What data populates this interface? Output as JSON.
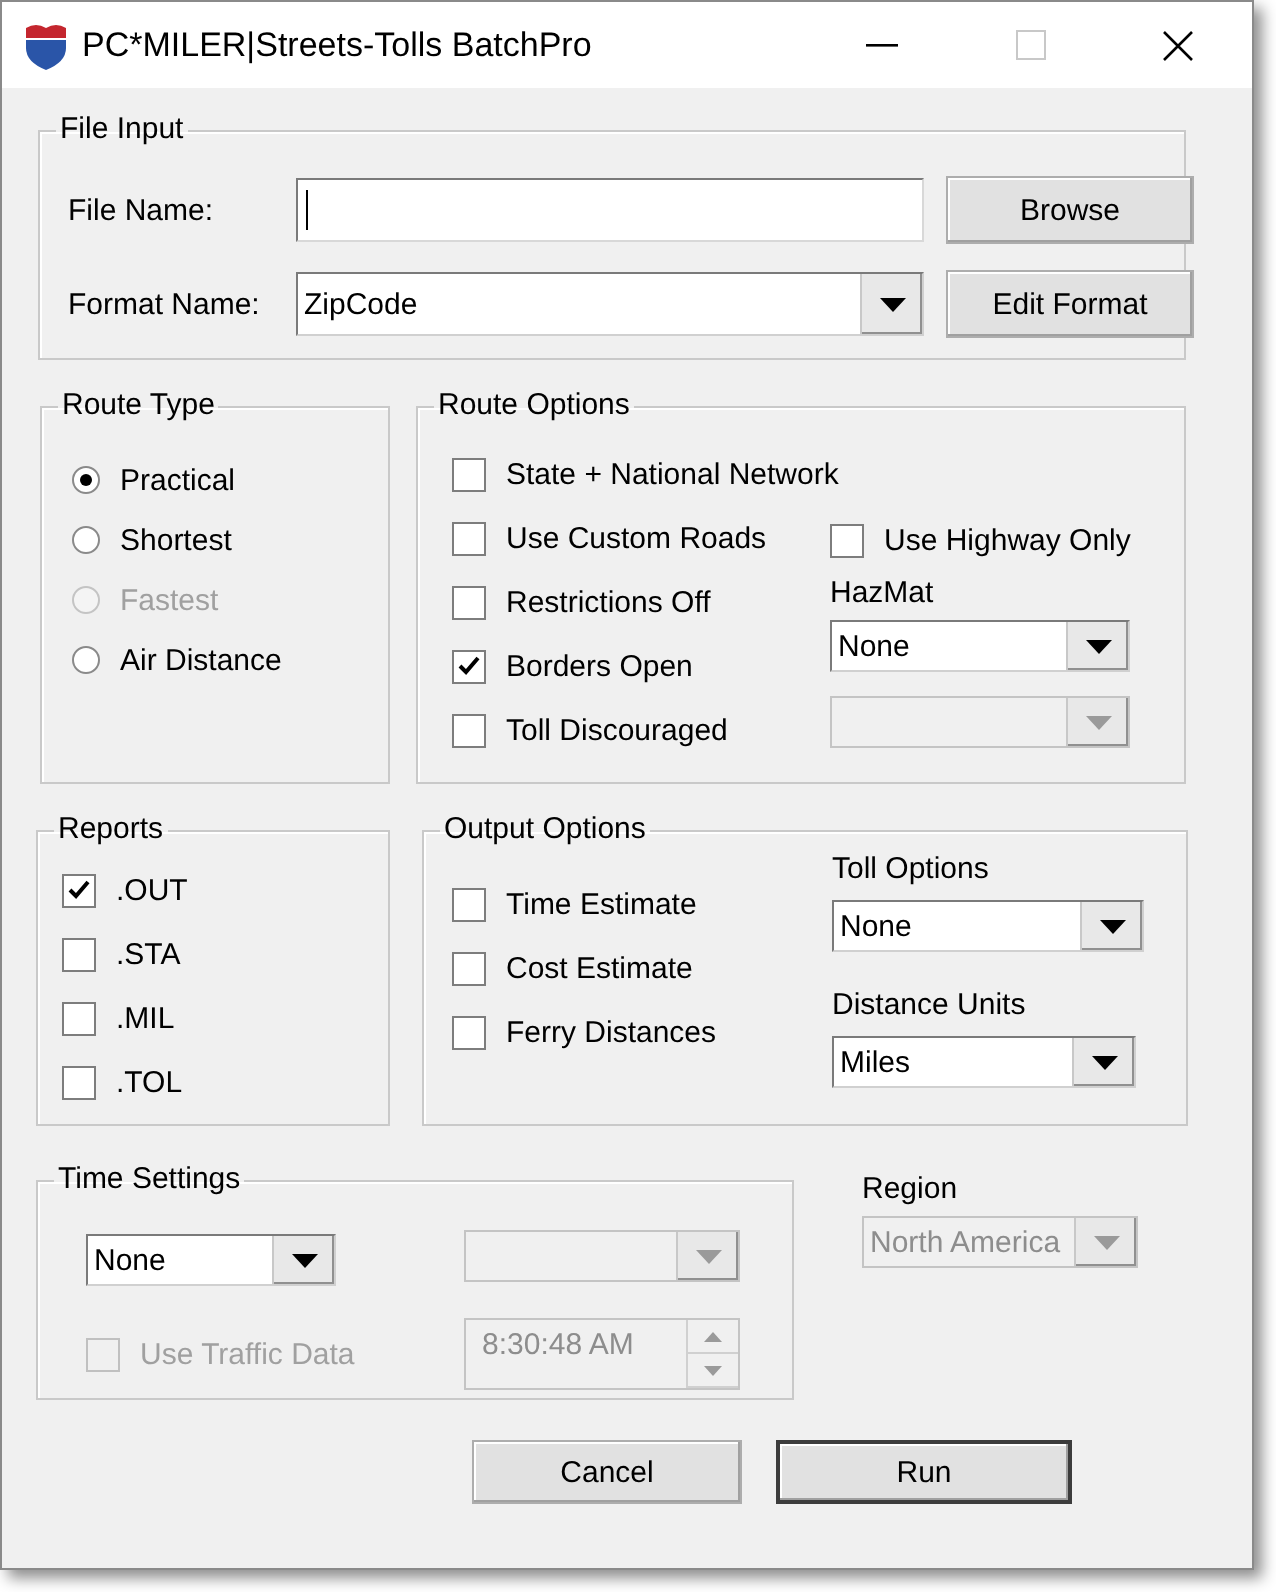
{
  "window": {
    "title": "PC*MILER|Streets-Tolls BatchPro"
  },
  "file_input": {
    "title": "File Input",
    "file_name": {
      "label": "File Name:",
      "focused": true
    },
    "format_name": {
      "label": "Format Name:",
      "value": "ZipCode"
    },
    "buttons": [
      "Browse",
      "Edit Format"
    ]
  },
  "route_type": {
    "title": "Route Type",
    "options": [
      {
        "label": "Practical",
        "selected": true,
        "disabled": false
      },
      {
        "label": "Shortest",
        "selected": false,
        "disabled": false
      },
      {
        "label": "Fastest",
        "selected": false,
        "disabled": true
      },
      {
        "label": "Air Distance",
        "selected": false,
        "disabled": false
      }
    ]
  },
  "route_options": {
    "title": "Route Options",
    "checks": [
      {
        "label": "State + National Network",
        "checked": false
      },
      {
        "label": "Use Custom Roads",
        "checked": false
      },
      {
        "label": "Restrictions Off",
        "checked": false
      },
      {
        "label": "Borders Open",
        "checked": true
      },
      {
        "label": "Toll Discouraged",
        "checked": false
      }
    ],
    "highway_only": {
      "label": "Use Highway Only",
      "checked": false
    },
    "hazmat": {
      "label": "HazMat",
      "value": "None"
    },
    "hazmat_detail": {
      "disabled": true
    }
  },
  "reports": {
    "title": "Reports",
    "items": [
      {
        "label": ".OUT",
        "checked": true
      },
      {
        "label": ".STA",
        "checked": false
      },
      {
        "label": ".MIL",
        "checked": false
      },
      {
        "label": ".TOL",
        "checked": false
      }
    ]
  },
  "output_options": {
    "title": "Output Options",
    "checks": [
      {
        "label": "Time Estimate",
        "checked": false
      },
      {
        "label": "Cost Estimate",
        "checked": false
      },
      {
        "label": "Ferry Distances",
        "checked": false
      }
    ],
    "toll_options": {
      "label": "Toll Options",
      "value": "None"
    },
    "distance_units": {
      "label": "Distance Units",
      "value": "Miles"
    }
  },
  "time_settings": {
    "title": "Time Settings",
    "mode": {
      "value": "None",
      "disabled": false
    },
    "day": {
      "disabled": true
    },
    "traffic": {
      "label": "Use Traffic Data",
      "checked": false,
      "disabled": true
    },
    "time": {
      "value": "8:30:48 AM",
      "disabled": true
    }
  },
  "region": {
    "label": "Region",
    "value": "North America",
    "disabled": true
  },
  "buttons": [
    {
      "label": "Cancel",
      "default": false
    },
    {
      "label": "Run",
      "default": true
    }
  ]
}
